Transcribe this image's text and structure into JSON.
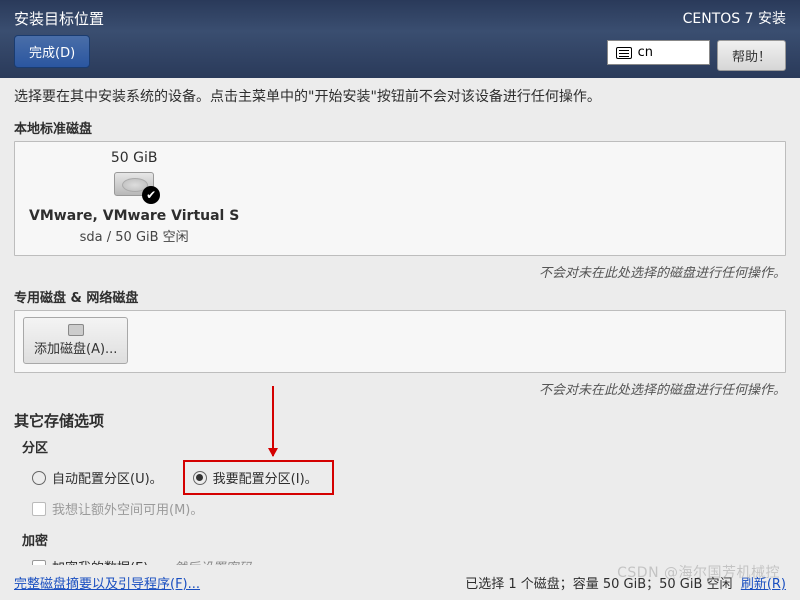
{
  "header": {
    "title": "安装目标位置",
    "subtitle": "CENTOS 7 安装",
    "done_btn": "完成(D)",
    "lang_code": "cn",
    "help_btn": "帮助！"
  },
  "intro": "选择要在其中安装系统的设备。点击主菜单中的\"开始安装\"按钮前不会对该设备进行任何操作。",
  "local_disks": {
    "label": "本地标准磁盘",
    "items": [
      {
        "size": "50 GiB",
        "name": "VMware, VMware Virtual S",
        "detail": "sda    /    50 GiB 空闲",
        "selected": true
      }
    ],
    "note": "不会对未在此处选择的磁盘进行任何操作。"
  },
  "special_disks": {
    "label": "专用磁盘 & 网络磁盘",
    "add_btn": "添加磁盘(A)...",
    "note": "不会对未在此处选择的磁盘进行任何操作。"
  },
  "other": {
    "title": "其它存储选项",
    "partition": {
      "label": "分区",
      "auto": "自动配置分区(U)。",
      "manual": "我要配置分区(I)。",
      "extra_space": "我想让额外空间可用(M)。"
    },
    "encrypt": {
      "label": "加密",
      "chk": "加密我的数据(E)。",
      "hint": "然后设置密码。"
    }
  },
  "footer": {
    "link": "完整磁盘摘要以及引导程序(F)...",
    "status": "已选择 1 个磁盘；容量 50 GiB；50 GiB 空闲",
    "refresh": "刷新(R)"
  },
  "watermark": "CSDN @海尔国芳机械控"
}
